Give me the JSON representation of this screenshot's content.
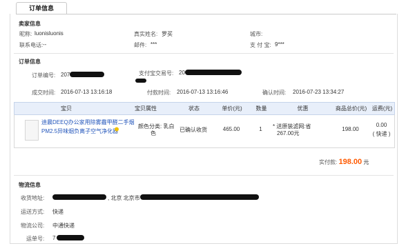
{
  "tab": {
    "label": "订单信息"
  },
  "seller": {
    "title": "卖家信息",
    "nickname_label": "昵称:",
    "nickname": "luonisluonis",
    "realname_label": "真实姓名:",
    "realname": "罗买",
    "city_label": "城市:",
    "city": "",
    "phone_label": "联系电话:",
    "phone": "--",
    "email_label": "邮件:",
    "email": "***",
    "alipay_label": "支 付 宝:",
    "alipay": "9***"
  },
  "order": {
    "title": "订单信息",
    "number_label": "订单编号:",
    "number": "207",
    "trade_label": "支付宝交易号:",
    "trade": "20",
    "created_label": "成交时间:",
    "created": "2016-07-13 13:16:18",
    "paid_label": "付款时间:",
    "paid": "2016-07-13 13:16:46",
    "confirm_label": "确认时间:",
    "confirm": "2016-07-23 13:34:27"
  },
  "table": {
    "headers": [
      "宝贝",
      "宝贝属性",
      "状态",
      "单价(元)",
      "数量",
      "优惠",
      "商品总价(元)",
      "运费(元)"
    ],
    "item": {
      "title_line1": "迪晨DEEQ办公家用除雾霾甲醛二手烟",
      "title_line2": "PM2.5异味烟负离子空气净化器",
      "attr_line1": "颜色分类: 乳白",
      "attr_line2": "色",
      "status": "已确认收货",
      "price": "465.00",
      "qty": "1",
      "discount_line1": "* 送原装滤网:省",
      "discount_line2": "267.00元",
      "total": "198.00",
      "shipping": "0.00",
      "shipping_note": "( 快递 )"
    }
  },
  "payment": {
    "label": "实付款:",
    "amount": "198.00",
    "unit": "元"
  },
  "logistics": {
    "title": "物流信息",
    "address_label": "收货地址:",
    "address_mid": ", 北京 北京市",
    "method_label": "运送方式:",
    "method": "快递",
    "company_label": "物流公司:",
    "company": "中通快递",
    "tracking_label": "运单号:",
    "tracking": "7"
  },
  "colors": {
    "accent_price": "#ff5a00",
    "link": "#2255bb",
    "table_header_bg": "#e8effa"
  }
}
